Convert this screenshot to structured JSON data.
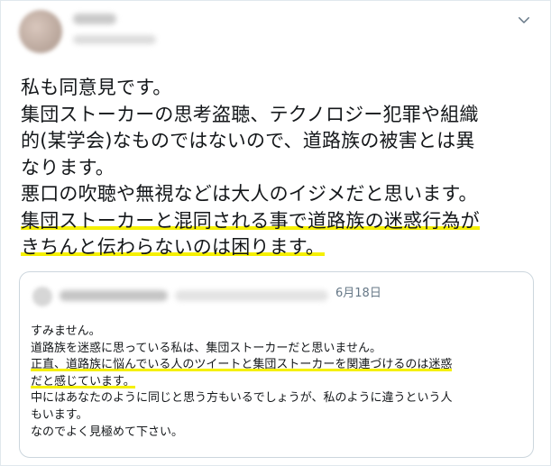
{
  "tweet": {
    "lines": [
      {
        "text": "私も同意見です。",
        "highlight": false
      },
      {
        "text": "集団ストーカーの思考盗聴、テクノロジー犯罪や組織",
        "highlight": false
      },
      {
        "text": "的(某学会)なものではないので、道路族の被害とは異",
        "highlight": false
      },
      {
        "text": "なります。",
        "highlight": false
      },
      {
        "text": "悪口の吹聴や無視などは大人のイジメだと思います。",
        "highlight": false
      },
      {
        "text": "集団ストーカーと混同される事で道路族の迷惑行為が",
        "highlight": true
      },
      {
        "text": "きちんと伝わらないのは困ります。",
        "highlight": true
      }
    ]
  },
  "quoted_tweet": {
    "date": "6月18日",
    "lines": [
      {
        "text": "すみません。",
        "highlight": false
      },
      {
        "text": "道路族を迷惑に思っている私は、集団ストーカーだと思いません。",
        "highlight": false
      },
      {
        "text": "正直、道路族に悩んでいる人のツイートと集団ストーカーを関連づけるのは迷惑",
        "highlight": true
      },
      {
        "text": "だと感じています。",
        "highlight": true
      },
      {
        "text": "中にはあなたのように同じと思う方もいるでしょうが、私のように違うという人",
        "highlight": false
      },
      {
        "text": "もいます。",
        "highlight": false
      },
      {
        "text": "なのでよく見極めて下さい。",
        "highlight": false
      }
    ]
  },
  "colors": {
    "highlight": "#f5f000",
    "text": "#14171a",
    "secondary_text": "#657786",
    "border": "#e1e8ed"
  },
  "icons": {
    "menu": "chevron-down-icon"
  }
}
